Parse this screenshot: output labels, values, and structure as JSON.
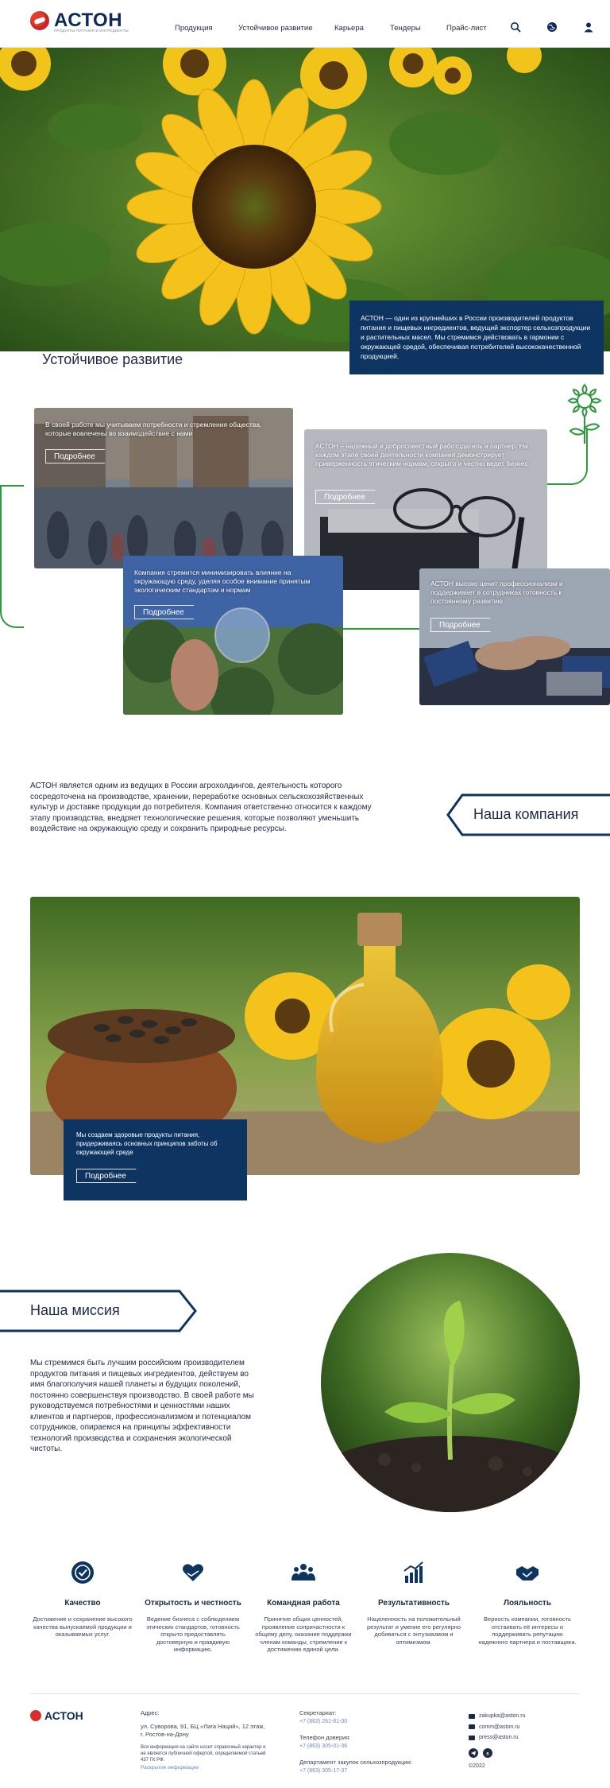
{
  "header": {
    "brand": "АСТОН",
    "brand_sub": "ПРОДУКТЫ ПИТАНИЯ И ИНГРЕДИЕНТЫ",
    "nav": [
      "Продукция",
      "Устойчивое развитие",
      "Карьера",
      "Тендеры",
      "Прайс-лист"
    ],
    "icons": [
      "search-icon",
      "globe-icon",
      "user-icon"
    ]
  },
  "hero": {
    "card_text": "АСТОН — один из крупнейших в России производителей продуктов питания и пищевых ингредиентов, ведущий экспортер сельхозпродукции и растительных масел. Мы стремимся действовать в гармонии с окружающей средой, обеспечивая потребителей высококачественной продукцией."
  },
  "sustainability": {
    "title": "Устойчивое развитие",
    "cards": [
      {
        "text": "В своей работе мы учитываем потребности и стремления общества, которые вовлечены во взаимодействие с нами",
        "button": "Подробнее"
      },
      {
        "text": "АСТОН – надежный и добросовестный работодатель и партнер. На каждом этапе своей деятельности компания демонстрирует приверженность этическим нормам, открыто и честно ведет бизнес",
        "button": "Подробнее"
      },
      {
        "text": "Компания стремится минимизировать влияние на окружающую среду, уделяя особое внимание принятым экологическим стандартам и нормам",
        "button": "Подробнее"
      },
      {
        "text": "АСТОН высоко ценит профессионализм и поддерживает в сотрудниках готовность к постоянному развитию",
        "button": "Подробнее"
      }
    ]
  },
  "about": {
    "text": "АСТОН является одним из ведущих в России агрохолдингов, деятельность которого сосредоточена на производстве, хранении, переработке основных сельскохозяйственных культур и доставке продукции до потребителя. Компания ответственно относится к каждому этапу производства, внедряет технологические решения, которые позволяют уменьшить воздействие на окружающую среду и сохранить природные ресурсы.",
    "tag": "Наша компания"
  },
  "oil": {
    "text": "Мы создаем здоровые продукты питания, придерживаясь основных принципов заботы об окружающей среде",
    "button": "Подробнее"
  },
  "mission": {
    "tag": "Наша миссия",
    "text": "Мы стремимся быть лучшим российским производителем продуктов питания и пищевых ингредиентов, действуем во имя благополучия нашей планеты и будущих поколений, постоянно совершенствуя производство. В своей работе мы руководствуемся потребностями и ценностями наших клиентов и партнеров, профессионализмом и потенциалом сотрудников, опираемся на принципы эффективности технологий производства и сохранения экологической чистоты."
  },
  "values": [
    {
      "icon": "quality-badge-icon",
      "title": "Качество",
      "text": "Достижение и сохранение высокого качества выпускаемой продукции и оказываемых услуг."
    },
    {
      "icon": "heart-hands-icon",
      "title": "Открытость и честность",
      "text": "Ведение бизнеса с соблюдением этических стандартов, готовность открыто предоставлять достоверную и правдивую информацию."
    },
    {
      "icon": "team-icon",
      "title": "Командная работа",
      "text": "Принятие общих ценностей, проявление сопричастности к общему делу, оказание поддержки членам команды, стремление к достижению единой цели."
    },
    {
      "icon": "chart-growth-icon",
      "title": "Результативность",
      "text": "Нацеленность на положительный результат и умение его регулярно добиваться с энтузиазмом и оптимизмом."
    },
    {
      "icon": "handshake-icon",
      "title": "Лояльность",
      "text": "Верность компании, готовность отстаивать её интересы и поддерживать репутацию надежного партнера и поставщика."
    }
  ],
  "footer": {
    "brand": "АСТОН",
    "address_label": "Адрес:",
    "address": "ул. Суворова, 91, БЦ «Лига Наций», 12 этаж, г. Ростов-на-Дону",
    "disclaimer": "Вся информация на сайте носит справочный характер и не является публичной офертой, определяемой статьей 437 ГК РФ.",
    "disclosure_link": "Раскрытие информации",
    "secretary_label": "Секретариат:",
    "secretary_phone": "+7 (863) 261-81-00",
    "trust_label": "Телефон доверия:",
    "trust_phone": "+7 (863) 305-01-36",
    "purchase_label": "Департамент закупок сельхозпродукции:",
    "purchase_phone": "+7 (863) 305-17-37",
    "emails": [
      "zakupka@aston.ru",
      "comm@aston.ru",
      "press@aston.ru"
    ],
    "copyright": "©2022"
  },
  "colors": {
    "navy": "#0e3561",
    "brand_blue": "#0e2a5c",
    "green": "#2f9a3d",
    "red": "#d7302a"
  }
}
